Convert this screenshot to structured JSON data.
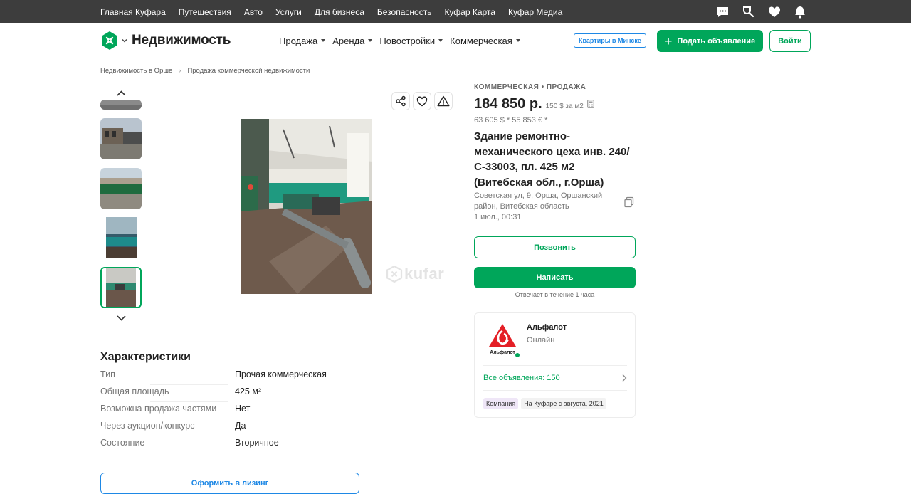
{
  "topbar": {
    "links": [
      "Главная Куфара",
      "Путешествия",
      "Авто",
      "Услуги",
      "Для бизнеса",
      "Безопасность",
      "Куфар Карта",
      "Куфар Медиа"
    ],
    "icons": [
      "chat-icon",
      "shield-search-icon",
      "heart-icon",
      "bell-icon"
    ]
  },
  "header": {
    "section": "Недвижимость",
    "nav": [
      "Продажа",
      "Аренда",
      "Новостройки",
      "Коммерческая"
    ],
    "minsk_label": "Квартиры в Минске",
    "post_ad": "Подать объявление",
    "login": "Войти"
  },
  "breadcrumbs": [
    "Недвижимость в Орше",
    "Продажа коммерческой недвижимости"
  ],
  "gallery": {
    "watermark": "kufar",
    "thumb_count": 5,
    "selected_index": 4
  },
  "characteristics": {
    "title": "Характеристики",
    "rows": [
      {
        "key": "Тип",
        "value": "Прочая коммерческая"
      },
      {
        "key": "Общая площадь",
        "value": "425 м²"
      },
      {
        "key": "Возможна продажа частями",
        "value": "Нет"
      },
      {
        "key": "Через аукцион/конкурс",
        "value": "Да"
      },
      {
        "key": "Состояние",
        "value": "Вторичное"
      }
    ]
  },
  "lease_button": "Оформить в лизинг",
  "listing": {
    "category": "КОММЕРЧЕСКАЯ • ПРОДАЖА",
    "price": "184 850 р.",
    "price_per_m2": "150 $ за м2",
    "alt_price": "63 605 $ *  55 853 € *",
    "title": "Здание ремонтно-механического цеха инв. 240/С-33003, пл. 425 м2 (Витебская обл., г.Орша)",
    "address": "Советская ул, 9, Орша, Оршанский район, Витебская область",
    "date": "1 июл., 00:31",
    "call": "Позвонить",
    "write": "Написать",
    "reply_time": "Отвечает в течение 1 часа"
  },
  "seller": {
    "logo_text": "Альфалот",
    "name": "Альфалот",
    "status": "Онлайн",
    "all_ads": "Все объявления: 150",
    "badges": [
      "Компания",
      "На Куфаре с августа, 2021"
    ]
  },
  "colors": {
    "accent": "#00a65a",
    "blue": "#1e88e5",
    "topbar": "#3d3d3d"
  }
}
